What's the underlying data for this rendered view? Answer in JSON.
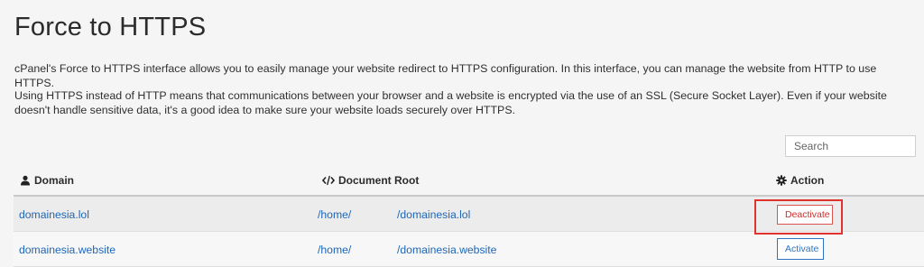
{
  "page": {
    "title": "Force to HTTPS",
    "intro_1": "cPanel's Force to HTTPS interface allows you to easily manage your website redirect to HTTPS configuration. In this interface, you can manage the website from HTTP to use HTTPS.",
    "intro_2": "Using HTTPS instead of HTTP means that communications between your browser and a website is encrypted via the use of an SSL (Secure Socket Layer). Even if your website doesn't handle sensitive data, it's a good idea to make sure your website loads securely over HTTPS."
  },
  "search": {
    "placeholder": "Search",
    "value": ""
  },
  "table": {
    "headers": {
      "domain": "Domain",
      "document_root": "Document Root",
      "action": "Action",
      "domain_icon": "user-icon",
      "document_root_icon": "code-icon",
      "action_icon": "gear-icon"
    },
    "rows": [
      {
        "domain": "domainesia.lol",
        "root_base": "/home/",
        "root_path": "/domainesia.lol",
        "action": "Deactivate",
        "highlighted": true
      },
      {
        "domain": "domainesia.website",
        "root_base": "/home/",
        "root_path": "/domainesia.website",
        "action": "Activate",
        "highlighted": false
      }
    ]
  },
  "colors": {
    "link": "#1f66b6",
    "deactivate": "#c9302c",
    "activate": "#2f74c0",
    "highlight_box": "#e0322f"
  }
}
